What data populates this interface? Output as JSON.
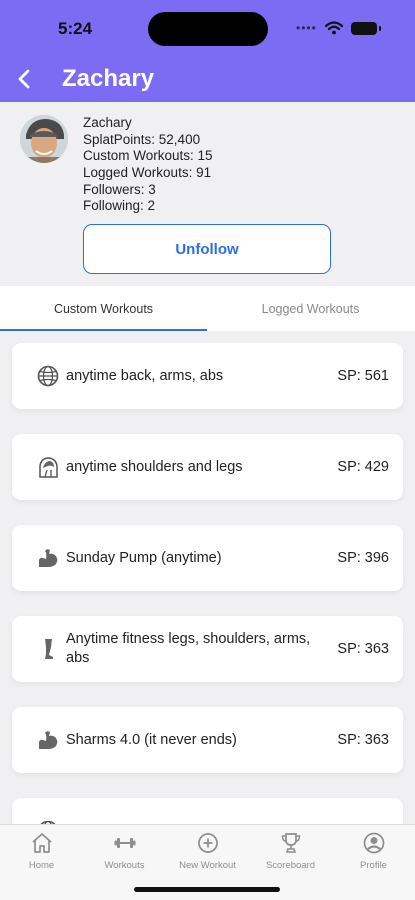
{
  "status": {
    "time": "5:24"
  },
  "nav": {
    "title": "Zachary"
  },
  "profile": {
    "name": "Zachary",
    "splat_points": "SplatPoints: 52,400",
    "custom_workouts": "Custom Workouts: 15",
    "logged_workouts": "Logged Workouts: 91",
    "followers": "Followers: 3",
    "following": "Following: 2",
    "unfollow_label": "Unfollow"
  },
  "tabs": {
    "custom": "Custom Workouts",
    "logged": "Logged Workouts",
    "active": "custom"
  },
  "workouts": [
    {
      "icon": "globe-icon",
      "name": "anytime back, arms, abs",
      "sp": "SP: 561"
    },
    {
      "icon": "shoulder-icon",
      "name": "anytime shoulders and legs",
      "sp": "SP: 429"
    },
    {
      "icon": "flexed-arm-icon",
      "name": "Sunday Pump (anytime)",
      "sp": "SP: 396"
    },
    {
      "icon": "leg-icon",
      "name": "Anytime fitness legs, shoulders, arms, abs",
      "sp": "SP: 363"
    },
    {
      "icon": "flexed-arm-icon",
      "name": "Sharms 4.0 (it never ends)",
      "sp": "SP: 363"
    },
    {
      "icon": "globe-icon",
      "name": "",
      "sp": ""
    }
  ],
  "tab_bar": {
    "home": "Home",
    "workouts": "Workouts",
    "new_workout": "New Workout",
    "scoreboard": "Scoreboard",
    "profile": "Profile"
  },
  "colors": {
    "header": "#7b6cf3",
    "accent": "#2d6fe0"
  }
}
